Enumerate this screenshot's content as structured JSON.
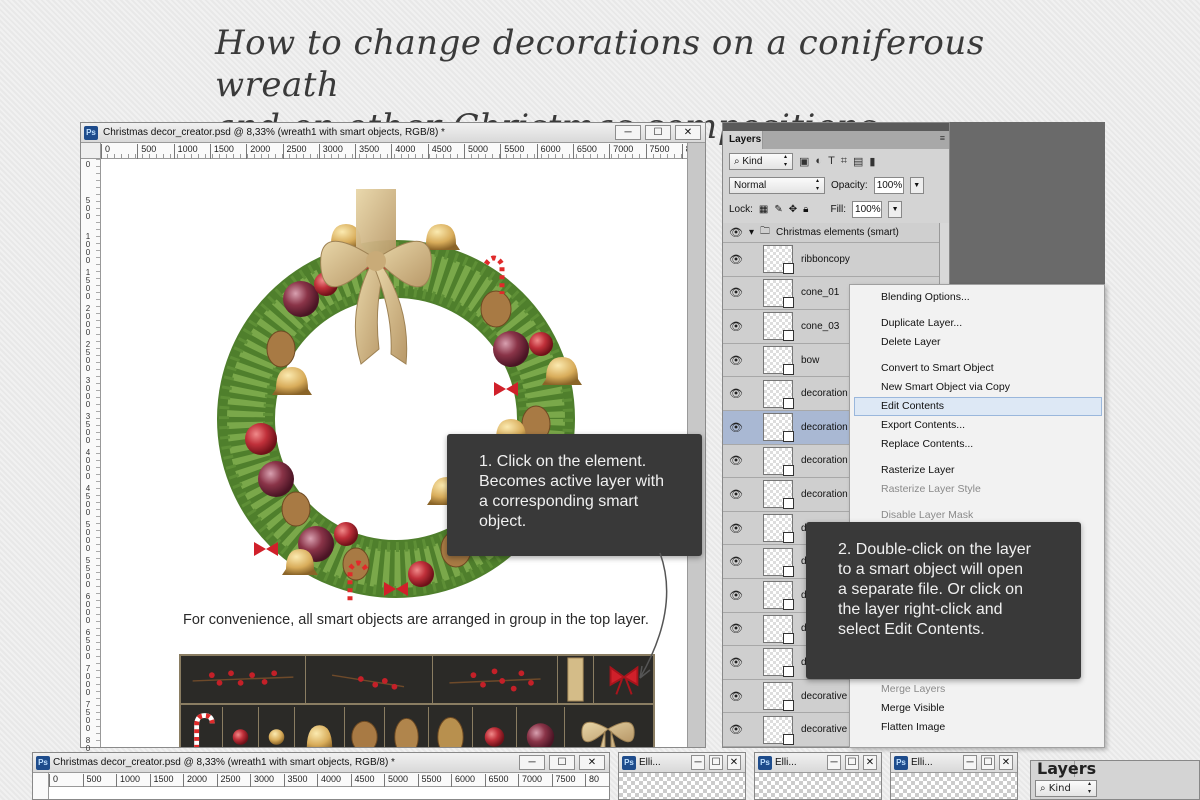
{
  "headline": {
    "line1": "How to change decorations on a coniferous wreath",
    "line2": "and on other Christmas compositions"
  },
  "document": {
    "title": "Christmas decor_creator.psd @ 8,33% (wreath1 with smart objects, RGB/8) *",
    "app_badge": "Ps",
    "buttons": {
      "minimize": "─",
      "maximize": "☐",
      "close": "✕"
    },
    "ruler_top": [
      "0",
      "500",
      "1000",
      "1500",
      "2000",
      "2500",
      "3000",
      "3500",
      "4000",
      "4500",
      "5000",
      "5500",
      "6000",
      "6500",
      "7000",
      "7500",
      "80"
    ],
    "ruler_left": [
      "0",
      "5\n0\n0",
      "1\n0\n0\n0",
      "1\n5\n0\n0",
      "2\n0\n0\n0",
      "2\n5\n0\n0",
      "3\n0\n0\n0",
      "3\n5\n0\n0",
      "4\n0\n0\n0",
      "4\n5\n0\n0",
      "5\n0\n0\n0",
      "5\n5\n0\n0",
      "6\n0\n0\n0",
      "6\n5\n0\n0",
      "7\n0\n0\n0",
      "7\n5\n0\n0",
      "8\n0\n0\n0"
    ]
  },
  "canvas_note": "For convenience, all smart objects are arranged in group in the top layer.",
  "callout_1": {
    "line1": "1. Click on the element.",
    "line2": "Becomes active layer with",
    "line3": "a corresponding smart",
    "line4": "object."
  },
  "callout_2": {
    "line1": "2. Double-click on the layer",
    "line2": "to a smart object will open",
    "line3": "a separate file. Or click on",
    "line4": "the layer right-click  and",
    "line5": "select Edit Contents."
  },
  "layers_panel": {
    "tab": "Layers",
    "menu_icon": "≡",
    "kind_label": "Kind",
    "blend_mode": "Normal",
    "opacity_label": "Opacity:",
    "opacity_value": "100%",
    "lock_label": "Lock:",
    "fill_label": "Fill:",
    "fill_value": "100%",
    "group_name": "Christmas elements (smart)",
    "layers": [
      {
        "name": "ribboncopy"
      },
      {
        "name": "cone_01"
      },
      {
        "name": "cone_03"
      },
      {
        "name": "bow"
      },
      {
        "name": "decoration"
      },
      {
        "name": "decoration"
      },
      {
        "name": "decoration"
      },
      {
        "name": "decoration"
      },
      {
        "name": "d"
      },
      {
        "name": "d"
      },
      {
        "name": "d"
      },
      {
        "name": "d"
      },
      {
        "name": "d"
      },
      {
        "name": "decorative"
      },
      {
        "name": "decorative"
      }
    ]
  },
  "context_menu": {
    "items": [
      {
        "label": "Blending Options...",
        "disabled": false
      },
      {
        "label": "Duplicate Layer...",
        "disabled": false
      },
      {
        "label": "Delete Layer",
        "disabled": false
      },
      {
        "label": "Convert to Smart Object",
        "disabled": false
      },
      {
        "label": "New Smart Object via Copy",
        "disabled": false
      },
      {
        "label": "Edit Contents",
        "disabled": false,
        "highlighted": true
      },
      {
        "label": "Export Contents...",
        "disabled": false
      },
      {
        "label": "Replace Contents...",
        "disabled": false
      },
      {
        "label": "Rasterize Layer",
        "disabled": false
      },
      {
        "label": "Rasterize Layer Style",
        "disabled": true
      },
      {
        "label": "Disable Layer Mask",
        "disabled": true
      },
      {
        "label": "Merge Layers",
        "disabled": true
      },
      {
        "label": "Merge Visible",
        "disabled": false
      },
      {
        "label": "Flatten Image",
        "disabled": false
      }
    ]
  },
  "bottom_strip": {
    "doc_title": "Christmas decor_creator.psd @ 8,33% (wreath1 with smart objects, RGB/8) *",
    "ruler_top": [
      "0",
      "500",
      "1000",
      "1500",
      "2000",
      "2500",
      "3000",
      "3500",
      "4000",
      "4500",
      "5000",
      "5500",
      "6000",
      "6500",
      "7000",
      "7500",
      "80"
    ],
    "mini_windows": [
      {
        "title": "Elli..."
      },
      {
        "title": "Elli..."
      },
      {
        "title": "Elli..."
      }
    ],
    "layers_tab": "Layers",
    "kind_label": "Kind"
  },
  "colors": {
    "callout_bg": "#393939",
    "palette_bg": "#2b2a27",
    "palette_border": "#8a7d62",
    "active_layer": "#a9b8d3",
    "menu_highlight": "#dde8f5"
  }
}
